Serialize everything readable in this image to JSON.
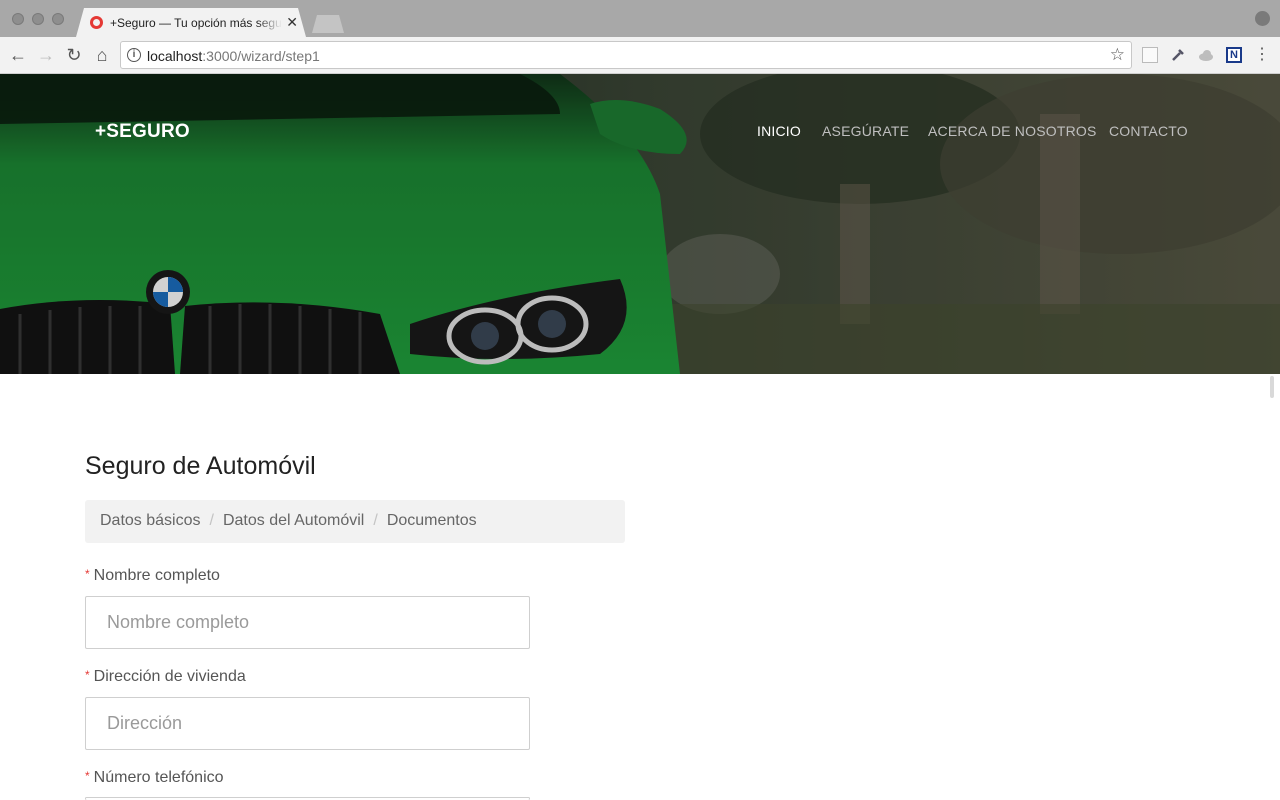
{
  "browser": {
    "tab_title": "+Seguro — Tu opción más segura",
    "url_host": "localhost",
    "url_path": ":3000/wizard/step1"
  },
  "site": {
    "logo": "+SEGURO",
    "nav": [
      "INICIO",
      "ASEGÚRATE",
      "ACERCA DE NOSOTROS",
      "CONTACTO"
    ],
    "active_nav": "INICIO"
  },
  "form": {
    "title": "Seguro de Automóvil",
    "steps": [
      "Datos básicos",
      "Datos del Automóvil",
      "Documentos"
    ],
    "fields": [
      {
        "label": "Nombre completo",
        "placeholder": "Nombre completo",
        "required": true
      },
      {
        "label": "Dirección de vivienda",
        "placeholder": "Dirección",
        "required": true
      },
      {
        "label": "Número telefónico",
        "placeholder": "",
        "required": true
      }
    ]
  },
  "colors": {
    "required_marker": "#e53935",
    "hero_green": "#1f8f3a"
  }
}
